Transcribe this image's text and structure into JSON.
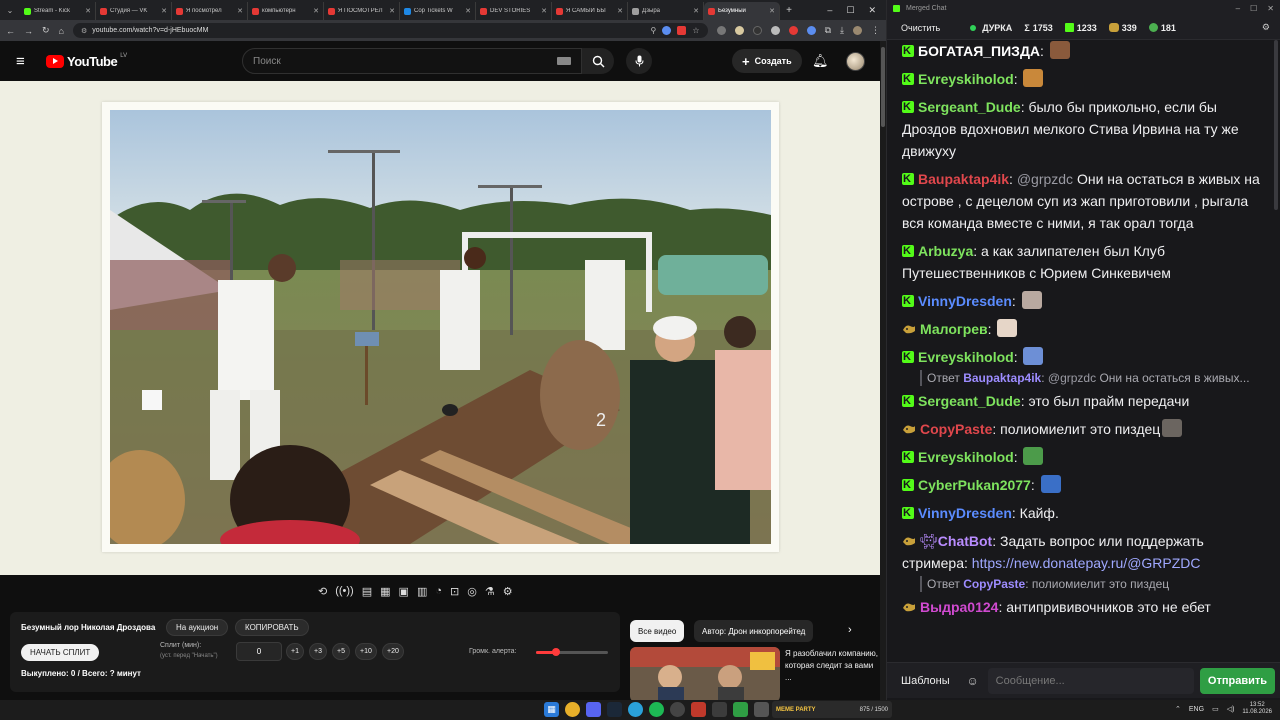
{
  "browser": {
    "tabs": [
      {
        "label": "Stream - Kick",
        "color": "#53fc18",
        "active": false
      },
      {
        "label": "Студия — VK",
        "color": "#e53935",
        "active": false
      },
      {
        "label": "Я посмотрел",
        "color": "#e53935",
        "active": false
      },
      {
        "label": "компьютерн",
        "color": "#e53935",
        "active": false
      },
      {
        "label": "Я ПОСМОТРЕЛ",
        "color": "#e53935",
        "active": false
      },
      {
        "label": "Cop Tickets W",
        "color": "#1e88e5",
        "active": false
      },
      {
        "label": "DEV STORIES",
        "color": "#e53935",
        "active": false
      },
      {
        "label": "Я САМЫЙ БЫ",
        "color": "#e53935",
        "active": false
      },
      {
        "label": "Дзыра",
        "color": "#9e9e9e",
        "active": false
      },
      {
        "label": "Безумный",
        "color": "#e53935",
        "active": true
      }
    ],
    "url": "youtube.com/watch?v=d-jHEbuocMM"
  },
  "youtube": {
    "logo_text": "YouTube",
    "region": "LV",
    "search_placeholder": "Поиск",
    "create_label": "Создать"
  },
  "toolbar_icons": [
    "loop-icon",
    "radio-icon",
    "playlist-icon",
    "clapper-icon",
    "frame-icon",
    "filmstrip-icon",
    "speed-icon",
    "caption-icon",
    "screenshot-icon",
    "flask-icon",
    "gear-icon"
  ],
  "control_panel": {
    "title": "Безумный лор Николая Дроздова",
    "auction_label": "На аукцион",
    "copy_label": "КОПИРОВАТЬ",
    "start_split_label": "НАЧАТЬ СПЛИТ",
    "split_label": "Сплит (мин):",
    "split_hint": "(уст. перед \"Начать\")",
    "split_value": "0",
    "increments": [
      "+1",
      "+3",
      "+5",
      "+10",
      "+20"
    ],
    "volume_label": "Громк. алерта:",
    "volume_fraction": 0.28,
    "bought_text": "Выкуплено: 0 / Всего: ? минут"
  },
  "related": {
    "chip_all": "Все видео",
    "chip_author": "Автор: Дрон инкорпорейтед",
    "video_title": "Я разоблачил компанию, которая следит за вами ..."
  },
  "chat": {
    "window_title": "Merged Chat",
    "clear_label": "Очистить",
    "channel": "ДУРКА",
    "stats": [
      {
        "icon": "Σ",
        "value": "1753"
      },
      {
        "icon": "K",
        "value": "1233"
      },
      {
        "icon": "twitch",
        "value": "339"
      },
      {
        "icon": "vk",
        "value": "181"
      }
    ],
    "messages": [
      {
        "platform": "kick",
        "user": "БОГАТАЯ_ПИЗДА",
        "color": "#ffffff",
        "text": "",
        "emote": "#8a5a3c"
      },
      {
        "platform": "kick",
        "user": "Evreyskiholod",
        "color": "#7ee35e",
        "text": "",
        "emote": "#c9883a"
      },
      {
        "platform": "kick",
        "user": "Sergeant_Dude",
        "color": "#7ee35e",
        "text": "было бы прикольно, если бы Дроздов вдохновил мелкого Стива Ирвина на ту же движуху"
      },
      {
        "platform": "kick",
        "user": "Baupaktap4ik",
        "color": "#e0474c",
        "mention": "@grpzdc",
        "text": "Они на остаться в живых на острове , с децелом суп из жап приготовили , рыгала вся команда вместе с ними, я так орал тогда"
      },
      {
        "platform": "kick",
        "user": "Arbuzya",
        "color": "#7ee35e",
        "text": "а как залипателен был Клуб Путешественников с Юрием Синкевичем"
      },
      {
        "platform": "kick",
        "user": "VinnyDresden",
        "color": "#5b8cff",
        "text": "",
        "emote": "#b9a9a0"
      },
      {
        "platform": "twitch",
        "user": "Малогрев",
        "color": "#7ee35e",
        "text": "",
        "emote": "#e6d6c8"
      },
      {
        "platform": "kick",
        "user": "Evreyskiholod",
        "color": "#7ee35e",
        "text": "",
        "emote": "#6d8fd6"
      },
      {
        "platform": "reply",
        "label": "Ответ",
        "user": "Baupaktap4ik",
        "mention": "@grpzdc",
        "text": "Они на остаться в живых..."
      },
      {
        "platform": "kick",
        "user": "Sergeant_Dude",
        "color": "#7ee35e",
        "text": "это был прайм передачи"
      },
      {
        "platform": "twitch",
        "user": "CopyPaste",
        "color": "#e0474c",
        "text": "полиомиелит это пиздец",
        "emote": "#6b6560"
      },
      {
        "platform": "kick",
        "user": "Evreyskiholod",
        "color": "#7ee35e",
        "text": "",
        "emote": "#4c9b4a"
      },
      {
        "platform": "kick",
        "user": "CyberPukan2077",
        "color": "#7ee35e",
        "text": "",
        "emote": "#3a6fc7"
      },
      {
        "platform": "kick",
        "user": "VinnyDresden",
        "color": "#5b8cff",
        "text": "Кайф."
      },
      {
        "platform": "bot",
        "user": "ChatBot",
        "color": "#b98cff",
        "text": "Задать вопрос или поддержать стримера:",
        "link": "https://new.donatepay.ru/@GRPZDC"
      },
      {
        "platform": "reply",
        "label": "Ответ",
        "user": "CopyPaste",
        "text": "полиомиелит это пиздец"
      },
      {
        "platform": "twitch",
        "user": "Выдра0124",
        "color": "#d04ad0",
        "text": "антипрививочников это не ебет"
      }
    ],
    "templates_label": "Шаблоны",
    "input_placeholder": "Сообщение...",
    "send_label": "Отправить"
  },
  "taskbar": {
    "meter_label": "MEME PARTY",
    "meter_value": "875 / 1500",
    "lang": "ENG",
    "time": "13:52",
    "date": "11.08.2026"
  }
}
